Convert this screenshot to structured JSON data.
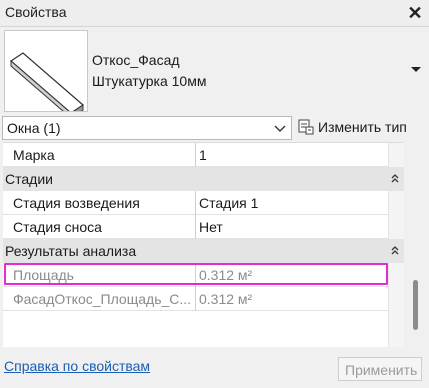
{
  "window": {
    "title": "Свойства",
    "close_glyph": "✕"
  },
  "type_selector": {
    "name": "Откос_Фасад",
    "subtitle": "Штукатурка 10мм",
    "preview_icon": "wall-slab-preview"
  },
  "filter": {
    "selected": "Окна (1)",
    "edit_type_label": "Изменить тип"
  },
  "properties": {
    "rows_top": [
      {
        "label": "Марка",
        "value": "1"
      }
    ],
    "categories": [
      {
        "label": "Стадии",
        "rows": [
          {
            "label": "Стадия возведения",
            "value": "Стадия 1"
          },
          {
            "label": "Стадия сноса",
            "value": "Нет"
          }
        ]
      },
      {
        "label": "Результаты анализа",
        "rows": [
          {
            "label": "Площадь",
            "value": "0.312 м²"
          },
          {
            "label": "ФасадОткос_Площадь_С...",
            "value": "0.312 м²"
          }
        ]
      }
    ]
  },
  "footer": {
    "help_link": "Справка по свойствам",
    "apply_button": "Применить"
  },
  "colors": {
    "highlight": "#e52bd3",
    "link": "#1a5fb4"
  }
}
